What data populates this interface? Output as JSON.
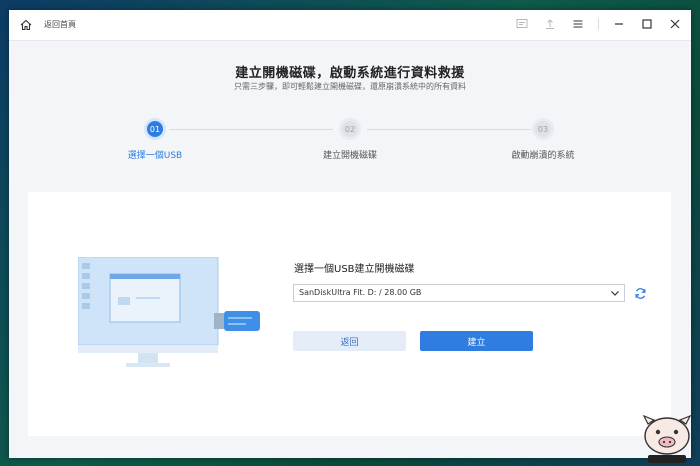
{
  "titlebar": {
    "back_label": "返回首頁",
    "icons": [
      "home-icon",
      "feedback-icon",
      "upload-icon",
      "menu-icon",
      "minimize-icon",
      "maximize-icon",
      "close-icon"
    ]
  },
  "heading": {
    "title": "建立開機磁碟，啟動系統進行資料救援",
    "subtitle": "只需三步驟，即可輕鬆建立開機磁碟，還原崩潰系統中的所有資料"
  },
  "steps": [
    {
      "number": "01",
      "label": "選擇一個USB",
      "active": true
    },
    {
      "number": "02",
      "label": "建立開機磁碟",
      "active": false
    },
    {
      "number": "03",
      "label": "啟動崩潰的系統",
      "active": false
    }
  ],
  "form": {
    "usb_label": "選擇一個USB建立開機磁碟",
    "selected_usb": "SanDiskUltra Fit. D: / 28.00 GB",
    "back_button": "返回",
    "create_button": "建立"
  },
  "colors": {
    "accent": "#2f7de1",
    "window_bg": "#f3f5f8",
    "panel_bg": "#ffffff"
  }
}
